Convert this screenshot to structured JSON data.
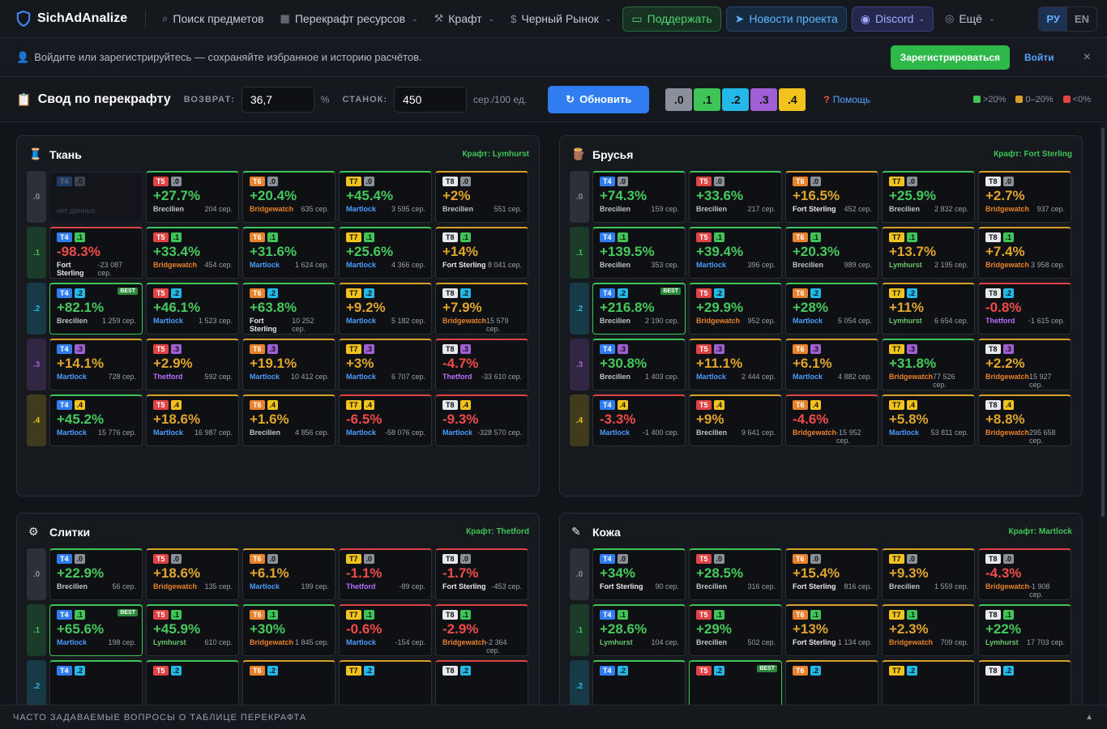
{
  "nav": {
    "brand": "SichAdAnalize",
    "items": [
      {
        "icon": "search-icon",
        "glyph": "⌕",
        "label": "Поиск предметов",
        "chev": false
      },
      {
        "icon": "grid-icon",
        "glyph": "▦",
        "label": "Перекрафт ресурсов",
        "chev": true
      },
      {
        "icon": "hammer-icon",
        "glyph": "⚒",
        "label": "Крафт",
        "chev": true
      },
      {
        "icon": "dollar-icon",
        "glyph": "$",
        "label": "Черный Рынок",
        "chev": true
      }
    ],
    "support": "Поддержать",
    "news": "Новости проекта",
    "discord": "Discord",
    "more": "Ещё",
    "lang_ru": "РУ",
    "lang_en": "EN"
  },
  "banner": {
    "message": "Войдите или зарегистрируйтесь — сохраняйте избранное и историю расчётов.",
    "register": "Зарегистрироваться",
    "login": "Войти",
    "close": "×"
  },
  "toolbar": {
    "title": "Свод по перекрафту",
    "return_label": "ВОЗВРАТ:",
    "return_value": "36,7",
    "return_unit": "%",
    "station_label": "СТАНОК:",
    "station_value": "450",
    "station_unit": "сер./100 ед.",
    "refresh": "Обновить",
    "enchants": [
      ".0",
      ".1",
      ".2",
      ".3",
      ".4"
    ],
    "help": "Помощь",
    "legend": [
      ">20%",
      "0–20%",
      "<0%"
    ]
  },
  "colors": {
    "green": "#3ec457",
    "yellow": "#d9a027",
    "red": "#e04343",
    "ench": [
      "#8a9099",
      "#3ec457",
      "#23b8e8",
      "#a15fd6",
      "#f2c31d"
    ],
    "tier": {
      "T4": "#2f7df0",
      "T5": "#e04343",
      "T6": "#e8822c",
      "T7": "#f2c31d",
      "T8": "#e6e8ec"
    }
  },
  "panels": [
    {
      "title": "Ткань",
      "icon": "cloth-icon",
      "glyph": "🧵",
      "craft": "Крафт: Lymhurst",
      "rows": [
        [
          null,
          [
            "T5",
            ".0",
            "+27.7%",
            "Brecilien",
            "204 сер."
          ],
          [
            "T6",
            ".0",
            "+20.4%",
            "Bridgewatch",
            "635 сер."
          ],
          [
            "T7",
            ".0",
            "+45.4%",
            "Martlock",
            "3 595 сер."
          ],
          [
            "T8",
            ".0",
            "+2%",
            "Brecilien",
            "551 сер."
          ]
        ],
        [
          [
            "T4",
            ".1",
            "-98.3%",
            "Fort Sterling",
            "-23 087 сер."
          ],
          [
            "T5",
            ".1",
            "+33.4%",
            "Bridgewatch",
            "454 сер."
          ],
          [
            "T6",
            ".1",
            "+31.6%",
            "Martlock",
            "1 624 сер."
          ],
          [
            "T7",
            ".1",
            "+25.6%",
            "Martlock",
            "4 366 сер."
          ],
          [
            "T8",
            ".1",
            "+14%",
            "Fort Sterling",
            "8 041 сер."
          ]
        ],
        [
          [
            "T4",
            ".2",
            "+82.1%",
            "Brecilien",
            "1 259 сер.",
            true
          ],
          [
            "T5",
            ".2",
            "+46.1%",
            "Martlock",
            "1 523 сер."
          ],
          [
            "T6",
            ".2",
            "+63.8%",
            "Fort Sterling",
            "10 252 сер."
          ],
          [
            "T7",
            ".2",
            "+9.2%",
            "Martlock",
            "5 182 сер."
          ],
          [
            "T8",
            ".2",
            "+7.9%",
            "Bridgewatch",
            "15 579 сер."
          ]
        ],
        [
          [
            "T4",
            ".3",
            "+14.1%",
            "Martlock",
            "728 сер."
          ],
          [
            "T5",
            ".3",
            "+2.9%",
            "Thetford",
            "592 сер."
          ],
          [
            "T6",
            ".3",
            "+19.1%",
            "Martlock",
            "10 412 сер."
          ],
          [
            "T7",
            ".3",
            "+3%",
            "Martlock",
            "6 707 сер."
          ],
          [
            "T8",
            ".3",
            "-4.7%",
            "Thetford",
            "-33 610 сер."
          ]
        ],
        [
          [
            "T4",
            ".4",
            "+45.2%",
            "Martlock",
            "15 776 сер."
          ],
          [
            "T5",
            ".4",
            "+18.6%",
            "Martlock",
            "16 987 сер."
          ],
          [
            "T6",
            ".4",
            "+1.6%",
            "Brecilien",
            "4 856 сер."
          ],
          [
            "T7",
            ".4",
            "-6.5%",
            "Martlock",
            "-58 076 сер."
          ],
          [
            "T8",
            ".4",
            "-9.3%",
            "Martlock",
            "-328 570 сер."
          ]
        ]
      ]
    },
    {
      "title": "Брусья",
      "icon": "wood-icon",
      "glyph": "🪵",
      "craft": "Крафт: Fort Sterling",
      "rows": [
        [
          [
            "T4",
            ".0",
            "+74.3%",
            "Brecilien",
            "159 сер."
          ],
          [
            "T5",
            ".0",
            "+33.6%",
            "Brecilien",
            "217 сер."
          ],
          [
            "T6",
            ".0",
            "+16.5%",
            "Fort Sterling",
            "452 сер."
          ],
          [
            "T7",
            ".0",
            "+25.9%",
            "Brecilien",
            "2 832 сер."
          ],
          [
            "T8",
            ".0",
            "+2.7%",
            "Bridgewatch",
            "937 сер."
          ]
        ],
        [
          [
            "T4",
            ".1",
            "+139.5%",
            "Brecilien",
            "353 сер."
          ],
          [
            "T5",
            ".1",
            "+39.4%",
            "Martlock",
            "396 сер."
          ],
          [
            "T6",
            ".1",
            "+20.3%",
            "Brecilien",
            "989 сер."
          ],
          [
            "T7",
            ".1",
            "+13.7%",
            "Lymhurst",
            "2 195 сер."
          ],
          [
            "T8",
            ".1",
            "+7.4%",
            "Bridgewatch",
            "3 958 сер."
          ]
        ],
        [
          [
            "T4",
            ".2",
            "+216.8%",
            "Brecilien",
            "2 190 сер.",
            true
          ],
          [
            "T5",
            ".2",
            "+29.9%",
            "Bridgewatch",
            "952 сер."
          ],
          [
            "T6",
            ".2",
            "+28%",
            "Martlock",
            "5 054 сер."
          ],
          [
            "T7",
            ".2",
            "+11%",
            "Lymhurst",
            "6 654 сер."
          ],
          [
            "T8",
            ".2",
            "-0.8%",
            "Thetford",
            "-1 615 сер."
          ]
        ],
        [
          [
            "T4",
            ".3",
            "+30.8%",
            "Brecilien",
            "1 403 сер."
          ],
          [
            "T5",
            ".3",
            "+11.1%",
            "Martlock",
            "2 444 сер."
          ],
          [
            "T6",
            ".3",
            "+6.1%",
            "Martlock",
            "4 882 сер."
          ],
          [
            "T7",
            ".3",
            "+31.8%",
            "Bridgewatch",
            "77 526 сер."
          ],
          [
            "T8",
            ".3",
            "+2.2%",
            "Bridgewatch",
            "15 927 сер."
          ]
        ],
        [
          [
            "T4",
            ".4",
            "-3.3%",
            "Martlock",
            "-1 400 сер."
          ],
          [
            "T5",
            ".4",
            "+9%",
            "Brecilien",
            "9 641 сер."
          ],
          [
            "T6",
            ".4",
            "-4.6%",
            "Bridgewatch",
            "-15 952 сер."
          ],
          [
            "T7",
            ".4",
            "+5.8%",
            "Martlock",
            "53 811 сер."
          ],
          [
            "T8",
            ".4",
            "+8.8%",
            "Bridgewatch",
            "295 658 сер."
          ]
        ]
      ]
    },
    {
      "title": "Слитки",
      "icon": "gear-icon",
      "glyph": "⚙",
      "craft": "Крафт: Thetford",
      "rows": [
        [
          [
            "T4",
            ".0",
            "+22.9%",
            "Brecilien",
            "56 сер."
          ],
          [
            "T5",
            ".0",
            "+18.6%",
            "Bridgewatch",
            "135 сер."
          ],
          [
            "T6",
            ".0",
            "+6.1%",
            "Martlock",
            "199 сер."
          ],
          [
            "T7",
            ".0",
            "-1.1%",
            "Thetford",
            "-89 сер."
          ],
          [
            "T8",
            ".0",
            "-1.7%",
            "Fort Sterling",
            "-453 сер."
          ]
        ],
        [
          [
            "T4",
            ".1",
            "+65.6%",
            "Martlock",
            "198 сер.",
            true
          ],
          [
            "T5",
            ".1",
            "+45.9%",
            "Lymhurst",
            "610 сер."
          ],
          [
            "T6",
            ".1",
            "+30%",
            "Bridgewatch",
            "1 845 сер."
          ],
          [
            "T7",
            ".1",
            "-0.6%",
            "Martlock",
            "-154 сер."
          ],
          [
            "T8",
            ".1",
            "-2.9%",
            "Bridgewatch",
            "-2 364 сер."
          ]
        ],
        [
          [
            "T4",
            ".2",
            "",
            "",
            "",
            false,
            "g"
          ],
          [
            "T5",
            ".2",
            "",
            "",
            "",
            false,
            "g"
          ],
          [
            "T6",
            ".2",
            "",
            "",
            "",
            false,
            "y"
          ],
          [
            "T7",
            ".2",
            "",
            "",
            "",
            false,
            "y"
          ],
          [
            "T8",
            ".2",
            "",
            "",
            "",
            false,
            "r"
          ]
        ]
      ]
    },
    {
      "title": "Кожа",
      "icon": "leather-icon",
      "glyph": "✎",
      "craft": "Крафт: Martlock",
      "rows": [
        [
          [
            "T4",
            ".0",
            "+34%",
            "Fort Sterling",
            "90 сер."
          ],
          [
            "T5",
            ".0",
            "+28.5%",
            "Brecilien",
            "316 сер."
          ],
          [
            "T6",
            ".0",
            "+15.4%",
            "Fort Sterling",
            "816 сер."
          ],
          [
            "T7",
            ".0",
            "+9.3%",
            "Brecilien",
            "1 559 сер."
          ],
          [
            "T8",
            ".0",
            "-4.3%",
            "Bridgewatch",
            "-1 908 сер."
          ]
        ],
        [
          [
            "T4",
            ".1",
            "+28.6%",
            "Lymhurst",
            "104 сер."
          ],
          [
            "T5",
            ".1",
            "+29%",
            "Brecilien",
            "502 сер."
          ],
          [
            "T6",
            ".1",
            "+13%",
            "Fort Sterling",
            "1 134 сер."
          ],
          [
            "T7",
            ".1",
            "+2.3%",
            "Bridgewatch",
            "709 сер."
          ],
          [
            "T8",
            ".1",
            "+22%",
            "Lymhurst",
            "17 703 сер."
          ]
        ],
        [
          [
            "T4",
            ".2",
            "",
            "",
            "",
            false,
            "g"
          ],
          [
            "T5",
            ".2",
            "",
            "",
            "",
            true,
            "g"
          ],
          [
            "T6",
            ".2",
            "",
            "",
            "",
            false,
            "y"
          ],
          [
            "T7",
            ".2",
            "",
            "",
            "",
            false,
            "y"
          ],
          [
            "T8",
            ".2",
            "",
            "",
            "",
            false,
            "y"
          ]
        ]
      ]
    }
  ],
  "empty_text": "нет данных",
  "best_label": "BEST",
  "faq": "ЧАСТО ЗАДАВАЕМЫЕ ВОПРОСЫ О ТАБЛИЦЕ ПЕРЕКРАФТА"
}
